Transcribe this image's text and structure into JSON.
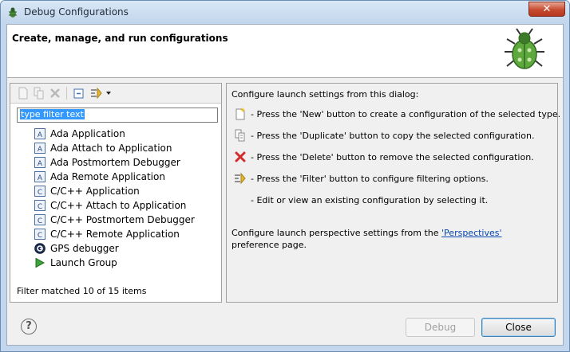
{
  "window": {
    "title": "Debug Configurations",
    "close_label": "✕"
  },
  "header": {
    "title": "Create, manage, and run configurations"
  },
  "filter": {
    "text": "type filter text"
  },
  "tree": {
    "items": [
      {
        "label": "Ada Application",
        "icon": "ada-icon"
      },
      {
        "label": "Ada Attach to Application",
        "icon": "ada-icon"
      },
      {
        "label": "Ada Postmortem Debugger",
        "icon": "ada-icon"
      },
      {
        "label": "Ada Remote Application",
        "icon": "ada-icon"
      },
      {
        "label": "C/C++ Application",
        "icon": "c-icon"
      },
      {
        "label": "C/C++ Attach to Application",
        "icon": "c-icon"
      },
      {
        "label": "C/C++ Postmortem Debugger",
        "icon": "c-icon"
      },
      {
        "label": "C/C++ Remote Application",
        "icon": "c-icon"
      },
      {
        "label": "GPS debugger",
        "icon": "gps-icon"
      },
      {
        "label": "Launch Group",
        "icon": "launch-icon"
      }
    ]
  },
  "status": "Filter matched 10 of 15 items",
  "right": {
    "intro": "Configure launch settings from this dialog:",
    "rows": [
      {
        "text": "- Press the 'New' button to create a configuration of the selected type.",
        "icon": "new-icon"
      },
      {
        "text": "- Press the 'Duplicate' button to copy the selected configuration.",
        "icon": "duplicate-icon"
      },
      {
        "text": "- Press the 'Delete' button to remove the selected configuration.",
        "icon": "delete-icon"
      },
      {
        "text": "- Press the 'Filter' button to configure filtering options.",
        "icon": "filter-icon"
      },
      {
        "text": "- Edit or view an existing configuration by selecting it.",
        "icon": ""
      }
    ],
    "perspective_prefix": "Configure launch perspective settings from the ",
    "perspective_link": "'Perspectives'",
    "perspective_suffix": " preference page."
  },
  "buttons": {
    "debug": "Debug",
    "close": "Close",
    "help": "?"
  },
  "colors": {
    "link": "#0645ad",
    "selection": "#3399ff",
    "delete": "#d22b2b"
  }
}
